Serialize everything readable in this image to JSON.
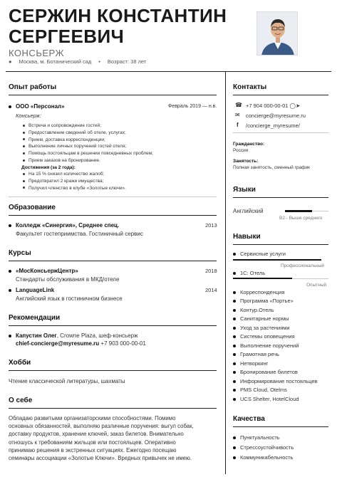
{
  "header": {
    "name_line1": "СЕРЖИН КОНСТАНТИН",
    "name_line2": "СЕРГЕЕВИЧ",
    "role": "КОНСЬЕРЖ",
    "location": "Москва, м. Ботанический сад",
    "age": "Возраст: 38 лет"
  },
  "experience": {
    "title": "Опыт работы",
    "company": "ООО «Персонал»",
    "dates": "Февраль 2019 — н.в.",
    "position": "Консьерж:",
    "duties": [
      "Встреча и сопровождение гостей;",
      "Предоставление сведений об отеле, услугах;",
      "Прием, доставка корреспонденции;",
      "Выполнение личных поручений гостей отеля;",
      "Помощь постояльцам в решении повседневных проблем;",
      "Прием заказов на бронирование."
    ],
    "ach_title": "Достижения (за 2 года):",
    "achievements": [
      "На 15 % снизил количество жалоб;",
      "Предотвратил 2 кражи имущества;",
      "Получил членство в клубе «Золотые ключи»."
    ]
  },
  "education": {
    "title": "Образование",
    "school": "Колледж «Синергия», Среднее спец.",
    "year": "2013",
    "faculty": "Факультет гостеприимства. Гостиничный сервис"
  },
  "courses": {
    "title": "Курсы",
    "items": [
      {
        "name": "«МосКонсьержЦентр»",
        "year": "2018",
        "desc": "Стандарты обслуживания в МКД/отеле"
      },
      {
        "name": "LanguageLink",
        "year": "2014",
        "desc": "Английский язык в гостиничном бизнесе"
      }
    ]
  },
  "recommendations": {
    "title": "Рекомендации",
    "person": "Капустин Олег",
    "rest": ", Crowne Plaza, шеф-консьерж",
    "email": "chief-concierge@myresume.ru",
    "phone": "+7 903 000-00-01"
  },
  "hobby": {
    "title": "Хобби",
    "text": "Чтение классической литературы, шахматы"
  },
  "about": {
    "title": "О себе",
    "lines": [
      "Обладаю развитыми организаторскими способностями. Помимо",
      "основных обязанностей, выполняю различные поручения: выгул собак,",
      "доставку продуктов, хранение ключей, заказ билетов. Внимательно",
      "отношусь к требованиям жильцов или постояльцев. Оперативно",
      "принимаю решения в экстренных ситуациях. Ежегодно посещаю",
      "семинары ассоциации «Золотые Ключи». Вредных привычек не имею."
    ]
  },
  "contacts": {
    "title": "Контакты",
    "phone": "+7 904 000-00-01",
    "email": "concierge@myresume.ru",
    "social": "/concierge_myresume/",
    "citizenship_label": "Гражданство:",
    "citizenship": "Россия",
    "employment_label": "Занятость:",
    "employment": "Полная занятость, сменный график"
  },
  "languages": {
    "title": "Языки",
    "name": "Английский",
    "level": "B2 - Выше среднего",
    "fill": 0.62
  },
  "skills": {
    "title": "Навыки",
    "rated": [
      {
        "name": "Сервисные услуги",
        "level": "Профессиональный",
        "fill": 0.92
      },
      {
        "name": "1С: Отель",
        "level": "Опытный",
        "fill": 0.62
      }
    ],
    "items": [
      "Корреспонденция",
      "Программа «Портье»",
      "Контур.Отель",
      "Санитарные нормы",
      "Уход за растениями",
      "Системы оповещения",
      "Выполнение поручений",
      "Грамотная речь",
      "Нетворкинг",
      "Бронирование билетов",
      "Информирование постояльцев",
      "PMS Cloud, Otelms",
      "UCS Shelter, HotelCloud"
    ]
  },
  "qualities": {
    "title": "Качества",
    "items": [
      "Пунктуальность",
      "Стрессоустойчивость",
      "Коммуникабельность"
    ]
  }
}
